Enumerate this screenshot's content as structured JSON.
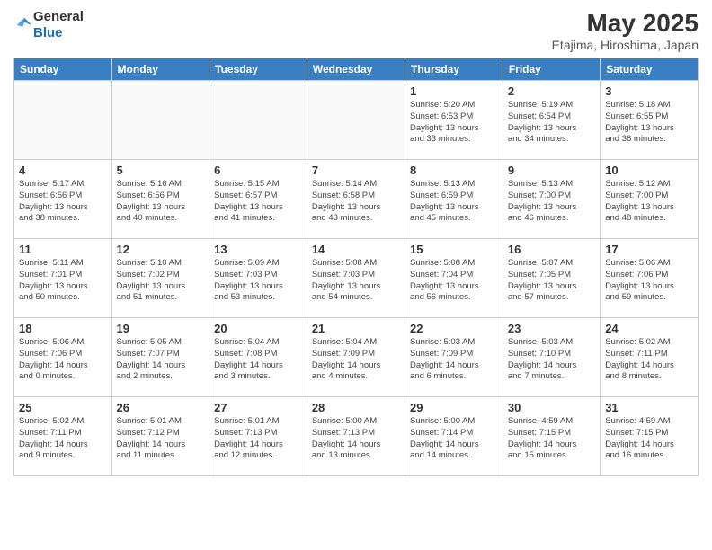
{
  "header": {
    "logo_general": "General",
    "logo_blue": "Blue",
    "month": "May 2025",
    "location": "Etajima, Hiroshima, Japan"
  },
  "weekdays": [
    "Sunday",
    "Monday",
    "Tuesday",
    "Wednesday",
    "Thursday",
    "Friday",
    "Saturday"
  ],
  "weeks": [
    [
      {
        "day": "",
        "info": ""
      },
      {
        "day": "",
        "info": ""
      },
      {
        "day": "",
        "info": ""
      },
      {
        "day": "",
        "info": ""
      },
      {
        "day": "1",
        "info": "Sunrise: 5:20 AM\nSunset: 6:53 PM\nDaylight: 13 hours\nand 33 minutes."
      },
      {
        "day": "2",
        "info": "Sunrise: 5:19 AM\nSunset: 6:54 PM\nDaylight: 13 hours\nand 34 minutes."
      },
      {
        "day": "3",
        "info": "Sunrise: 5:18 AM\nSunset: 6:55 PM\nDaylight: 13 hours\nand 36 minutes."
      }
    ],
    [
      {
        "day": "4",
        "info": "Sunrise: 5:17 AM\nSunset: 6:56 PM\nDaylight: 13 hours\nand 38 minutes."
      },
      {
        "day": "5",
        "info": "Sunrise: 5:16 AM\nSunset: 6:56 PM\nDaylight: 13 hours\nand 40 minutes."
      },
      {
        "day": "6",
        "info": "Sunrise: 5:15 AM\nSunset: 6:57 PM\nDaylight: 13 hours\nand 41 minutes."
      },
      {
        "day": "7",
        "info": "Sunrise: 5:14 AM\nSunset: 6:58 PM\nDaylight: 13 hours\nand 43 minutes."
      },
      {
        "day": "8",
        "info": "Sunrise: 5:13 AM\nSunset: 6:59 PM\nDaylight: 13 hours\nand 45 minutes."
      },
      {
        "day": "9",
        "info": "Sunrise: 5:13 AM\nSunset: 7:00 PM\nDaylight: 13 hours\nand 46 minutes."
      },
      {
        "day": "10",
        "info": "Sunrise: 5:12 AM\nSunset: 7:00 PM\nDaylight: 13 hours\nand 48 minutes."
      }
    ],
    [
      {
        "day": "11",
        "info": "Sunrise: 5:11 AM\nSunset: 7:01 PM\nDaylight: 13 hours\nand 50 minutes."
      },
      {
        "day": "12",
        "info": "Sunrise: 5:10 AM\nSunset: 7:02 PM\nDaylight: 13 hours\nand 51 minutes."
      },
      {
        "day": "13",
        "info": "Sunrise: 5:09 AM\nSunset: 7:03 PM\nDaylight: 13 hours\nand 53 minutes."
      },
      {
        "day": "14",
        "info": "Sunrise: 5:08 AM\nSunset: 7:03 PM\nDaylight: 13 hours\nand 54 minutes."
      },
      {
        "day": "15",
        "info": "Sunrise: 5:08 AM\nSunset: 7:04 PM\nDaylight: 13 hours\nand 56 minutes."
      },
      {
        "day": "16",
        "info": "Sunrise: 5:07 AM\nSunset: 7:05 PM\nDaylight: 13 hours\nand 57 minutes."
      },
      {
        "day": "17",
        "info": "Sunrise: 5:06 AM\nSunset: 7:06 PM\nDaylight: 13 hours\nand 59 minutes."
      }
    ],
    [
      {
        "day": "18",
        "info": "Sunrise: 5:06 AM\nSunset: 7:06 PM\nDaylight: 14 hours\nand 0 minutes."
      },
      {
        "day": "19",
        "info": "Sunrise: 5:05 AM\nSunset: 7:07 PM\nDaylight: 14 hours\nand 2 minutes."
      },
      {
        "day": "20",
        "info": "Sunrise: 5:04 AM\nSunset: 7:08 PM\nDaylight: 14 hours\nand 3 minutes."
      },
      {
        "day": "21",
        "info": "Sunrise: 5:04 AM\nSunset: 7:09 PM\nDaylight: 14 hours\nand 4 minutes."
      },
      {
        "day": "22",
        "info": "Sunrise: 5:03 AM\nSunset: 7:09 PM\nDaylight: 14 hours\nand 6 minutes."
      },
      {
        "day": "23",
        "info": "Sunrise: 5:03 AM\nSunset: 7:10 PM\nDaylight: 14 hours\nand 7 minutes."
      },
      {
        "day": "24",
        "info": "Sunrise: 5:02 AM\nSunset: 7:11 PM\nDaylight: 14 hours\nand 8 minutes."
      }
    ],
    [
      {
        "day": "25",
        "info": "Sunrise: 5:02 AM\nSunset: 7:11 PM\nDaylight: 14 hours\nand 9 minutes."
      },
      {
        "day": "26",
        "info": "Sunrise: 5:01 AM\nSunset: 7:12 PM\nDaylight: 14 hours\nand 11 minutes."
      },
      {
        "day": "27",
        "info": "Sunrise: 5:01 AM\nSunset: 7:13 PM\nDaylight: 14 hours\nand 12 minutes."
      },
      {
        "day": "28",
        "info": "Sunrise: 5:00 AM\nSunset: 7:13 PM\nDaylight: 14 hours\nand 13 minutes."
      },
      {
        "day": "29",
        "info": "Sunrise: 5:00 AM\nSunset: 7:14 PM\nDaylight: 14 hours\nand 14 minutes."
      },
      {
        "day": "30",
        "info": "Sunrise: 4:59 AM\nSunset: 7:15 PM\nDaylight: 14 hours\nand 15 minutes."
      },
      {
        "day": "31",
        "info": "Sunrise: 4:59 AM\nSunset: 7:15 PM\nDaylight: 14 hours\nand 16 minutes."
      }
    ]
  ]
}
